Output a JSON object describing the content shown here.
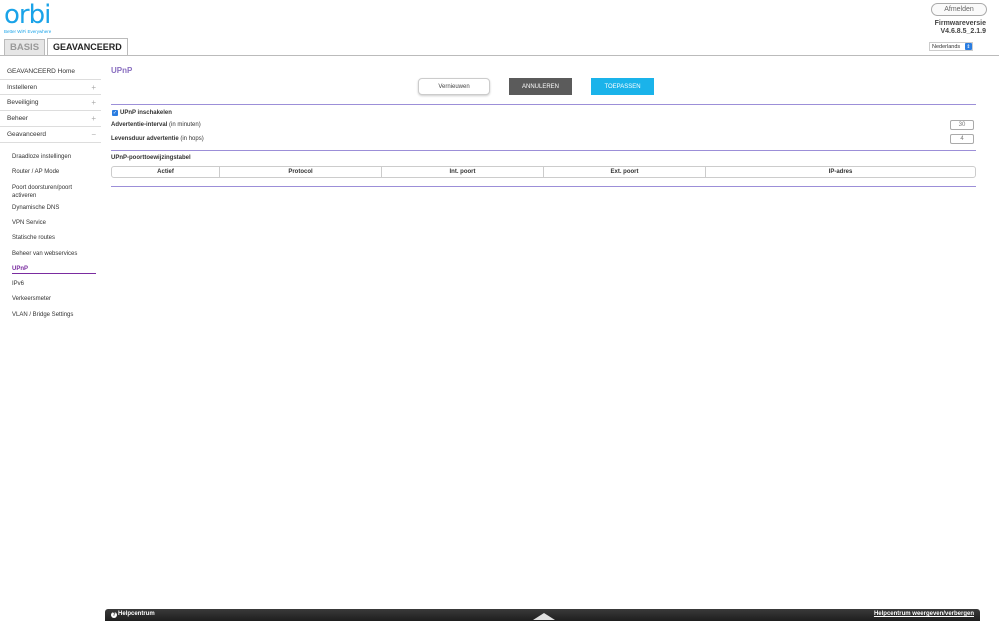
{
  "brand": {
    "logo": "orbi",
    "tagline": "Better WiFi Everywhere"
  },
  "tabs": [
    {
      "label": "BASIS"
    },
    {
      "label": "GEAVANCEERD"
    }
  ],
  "header": {
    "logout_label": "Afmelden",
    "firmware_label": "Firmwareversie",
    "firmware_value": "V4.6.8.5_2.1.9",
    "language": "Nederlands"
  },
  "sidebar": {
    "top_items": [
      {
        "label": "GEAVANCEERD Home",
        "expand": ""
      },
      {
        "label": "Instelleren",
        "expand": "+"
      },
      {
        "label": "Beveiliging",
        "expand": "+"
      },
      {
        "label": "Beheer",
        "expand": "+"
      },
      {
        "label": "Geavanceerd",
        "expand": "−"
      }
    ],
    "sub_items": [
      {
        "label": "Draadloze instellingen"
      },
      {
        "label": "Router / AP Mode"
      },
      {
        "label": "Poort doorsturen/poort activeren"
      },
      {
        "label": "Dynamische DNS"
      },
      {
        "label": "VPN Service"
      },
      {
        "label": "Statische routes"
      },
      {
        "label": "Beheer van webservices"
      },
      {
        "label": "UPnP"
      },
      {
        "label": "IPv6"
      },
      {
        "label": "Verkeersmeter"
      },
      {
        "label": "VLAN / Bridge Settings"
      }
    ]
  },
  "main": {
    "title": "UPnP",
    "buttons": {
      "refresh": "Vernieuwen",
      "cancel": "ANNULEREN",
      "apply": "TOEPASSEN"
    },
    "enable_label": "UPnP inschakelen",
    "ad_interval": {
      "label": "Advertentie-interval",
      "unit": " (in minuten)",
      "value": "30"
    },
    "ad_ttl": {
      "label": "Levensduur advertentie",
      "unit": " (in hops)",
      "value": "4"
    },
    "table_title": "UPnP-poorttoewijzingstabel",
    "columns": [
      "Actief",
      "Protocol",
      "Int. poort",
      "Ext. poort",
      "IP-adres"
    ]
  },
  "helpbar": {
    "left_label": "Helpcentrum",
    "right_label": "Helpcentrum weergeven/verbergen"
  },
  "colors": {
    "accent": "#8a6fc0",
    "apply": "#1ab3ea",
    "cancel": "#5b5b5b",
    "brand": "#1aa3e8"
  }
}
